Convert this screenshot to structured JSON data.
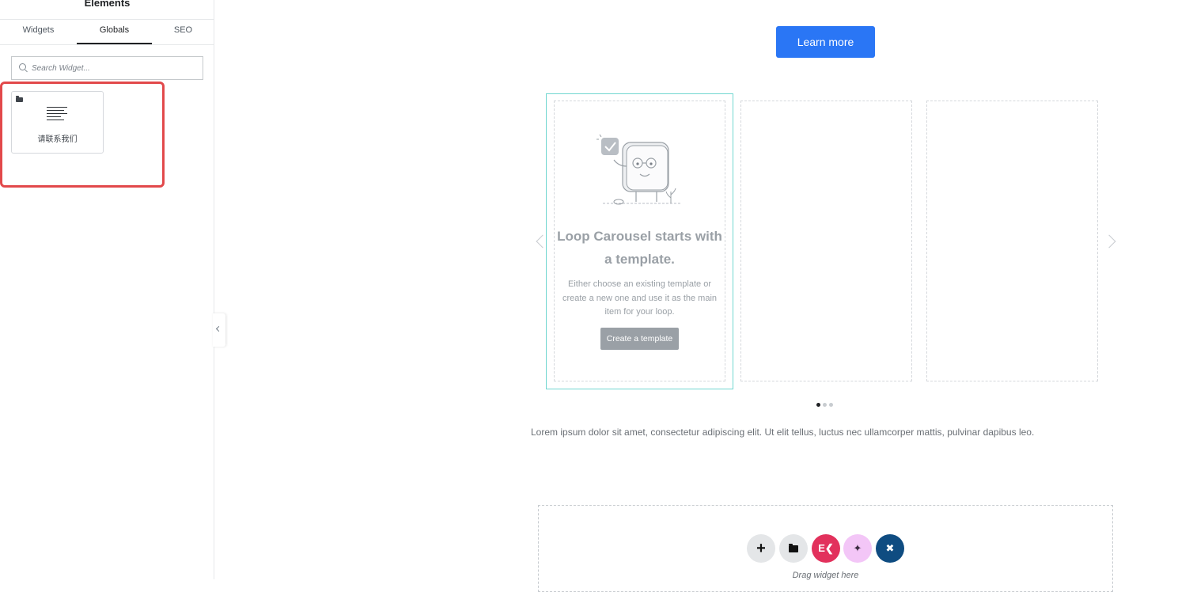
{
  "panel": {
    "title": "Elements",
    "tabs": [
      {
        "label": "Widgets",
        "active": false
      },
      {
        "label": "Globals",
        "active": true
      },
      {
        "label": "SEO",
        "active": false
      }
    ],
    "search": {
      "placeholder": "Search Widget...",
      "value": ""
    },
    "widgets": [
      {
        "label": "请联系我们",
        "icon": "text-editor-icon",
        "badge_icon": "folder-icon"
      }
    ],
    "highlight_color": "#e2494b"
  },
  "canvas": {
    "learn_more_label": "Learn more",
    "carousel": {
      "empty_title": "Loop Carousel starts with a template.",
      "empty_desc": "Either choose an existing template or create a new one and use it as the main item for your loop.",
      "create_label": "Create a template",
      "slides_count": 3,
      "active_dot": 0
    },
    "lorem": "Lorem ipsum dolor sit amet, consectetur adipiscing elit. Ut elit tellus, luctus nec ullamcorper mattis, pulvinar dapibus leo.",
    "drop_zone": {
      "drag_text": "Drag widget here",
      "buttons": [
        "add-icon",
        "folder-icon",
        "elementor-kit-icon",
        "ai-sparkle-icon",
        "plugin-icon"
      ]
    }
  },
  "colors": {
    "accent": "#2a76f5",
    "carousel_active_border": "#71d7d0",
    "kit_button": "#e2315c",
    "ai_button": "#f3c6f7",
    "plugin_button": "#0f4c81"
  }
}
